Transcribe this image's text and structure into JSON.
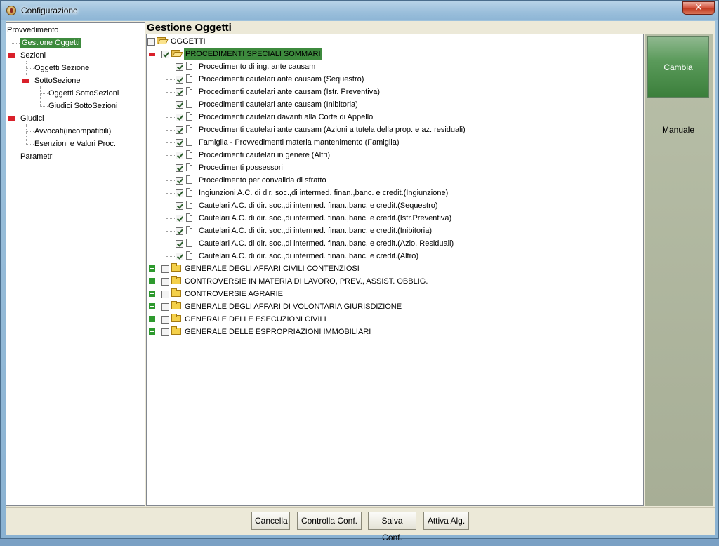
{
  "window": {
    "title": "Configurazione",
    "close_label": "✕"
  },
  "left_tree": {
    "root": "Provvedimento",
    "items": [
      {
        "label": "Gestione Oggetti",
        "selected": true
      },
      {
        "label": "Sezioni"
      },
      {
        "label": "Oggetti Sezione"
      },
      {
        "label": "SottoSezione"
      },
      {
        "label": "Oggetti SottoSezioni"
      },
      {
        "label": "Giudici SottoSezioni"
      },
      {
        "label": "Giudici"
      },
      {
        "label": "Avvocati(incompatibili)"
      },
      {
        "label": "Esenzioni e Valori Proc."
      },
      {
        "label": "Parametri"
      }
    ]
  },
  "main": {
    "title": "Gestione Oggetti",
    "root_label": "OGGETTI",
    "group_open": {
      "label": "PROCEDIMENTI SPECIALI SOMMARI",
      "children": [
        "Procedimento di ing. ante causam",
        "Procedimenti cautelari ante causam (Sequestro)",
        "Procedimenti cautelari ante causam (Istr. Preventiva)",
        "Procedimenti cautelari ante causam (Inibitoria)",
        "Procedimenti cautelari davanti alla Corte di Appello",
        "Procedimenti cautelari ante causam (Azioni a tutela della prop. e az. residuali)",
        "Famiglia - Provvedimenti materia mantenimento (Famiglia)",
        "Procedimenti cautelari in genere (Altri)",
        "Procedimenti possessori",
        "Procedimento per convalida di sfratto",
        "Ingiunzioni A.C. di dir. soc.,di intermed. finan.,banc. e credit.(Ingiunzione)",
        "Cautelari A.C. di dir. soc.,di intermed. finan.,banc. e credit.(Sequestro)",
        "Cautelari A.C. di dir. soc.,di intermed. finan.,banc. e credit.(Istr.Preventiva)",
        "Cautelari A.C. di dir. soc.,di intermed. finan.,banc. e credit.(Inibitoria)",
        "Cautelari A.C. di dir. soc.,di intermed. finan.,banc. e credit.(Azio. Residuali)",
        "Cautelari A.C. di dir. soc.,di intermed. finan.,banc. e credit.(Altro)"
      ]
    },
    "groups_collapsed": [
      "GENERALE DEGLI AFFARI CIVILI CONTENZIOSI",
      "CONTROVERSIE IN MATERIA DI LAVORO, PREV., ASSIST. OBBLIG.",
      "CONTROVERSIE AGRARIE",
      "GENERALE DEGLI AFFARI DI VOLONTARIA GIURISDIZIONE",
      "GENERALE DELLE ESECUZIONI CIVILI",
      "GENERALE DELLE ESPROPRIAZIONI IMMOBILIARI"
    ]
  },
  "side": {
    "cambia": "Cambia",
    "manuale": "Manuale"
  },
  "buttons": {
    "cancella": "Cancella",
    "controlla": "Controlla Conf.",
    "salva": "Salva Conf.",
    "attiva": "Attiva Alg."
  },
  "colors": {
    "selected_bg": "#3d8a3d",
    "minus": "#d9202a",
    "plus": "#2e9a2e"
  }
}
